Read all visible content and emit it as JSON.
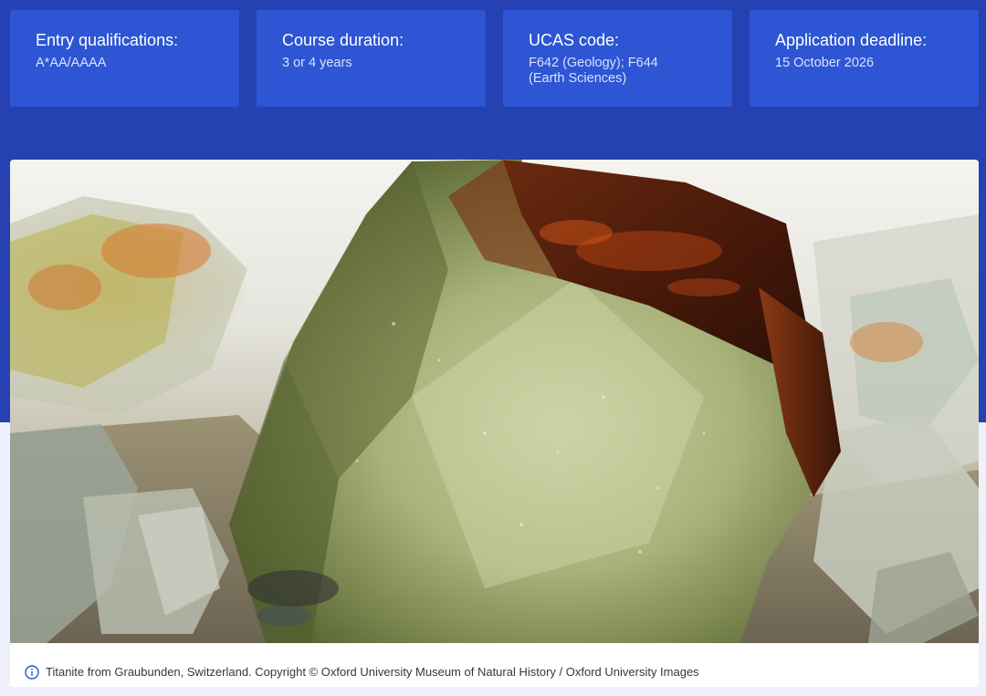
{
  "course_facts": [
    {
      "title": "Entry qualifications:",
      "value": "A*AA/AAAA"
    },
    {
      "title": "Course duration:",
      "value": "3 or 4 years"
    },
    {
      "title": "UCAS code:",
      "value": "F642 (Geology); F644 (Earth Sciences)"
    },
    {
      "title": "Application deadline:",
      "value": "15 October 2026"
    }
  ],
  "media": {
    "icon": "info-icon",
    "caption": "Titanite from Graubunden, Switzerland. Copyright © Oxford University Museum of Natural History / Oxford University Images"
  },
  "colors": {
    "band": "#2541b2",
    "card": "#2d55d4",
    "page_background": "#eef0fb",
    "info_icon": "#2d55d4"
  }
}
